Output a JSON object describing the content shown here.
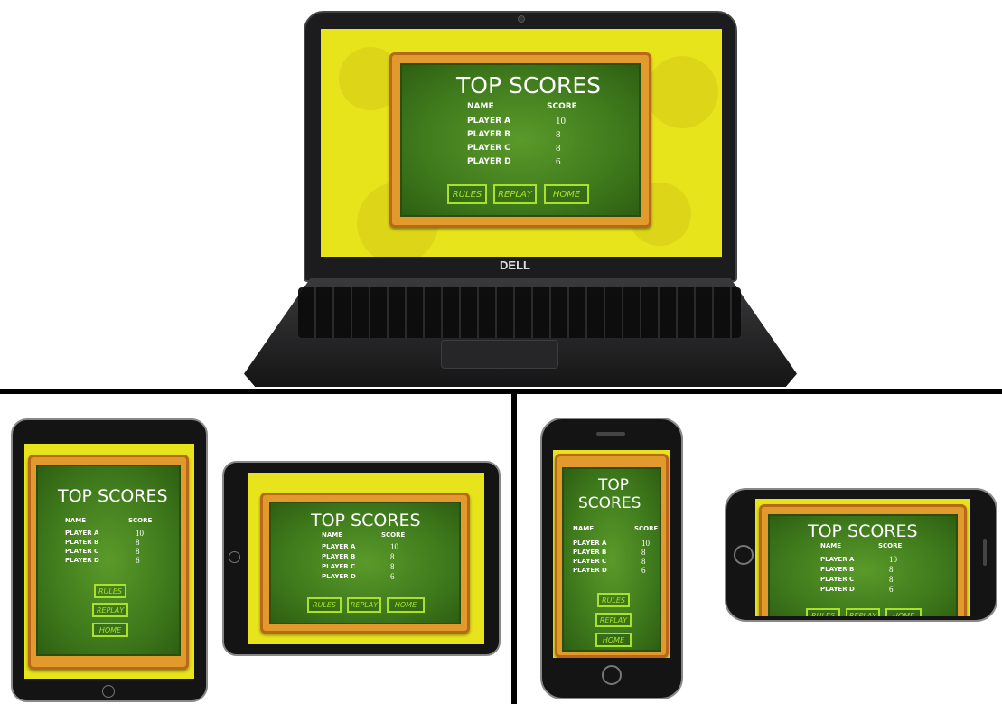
{
  "laptop_brand": "DELL",
  "game": {
    "title": "TOP SCORES",
    "title_line1": "TOP",
    "title_line2": "SCORES",
    "col_name": "NAME",
    "col_score": "SCORE",
    "players": [
      {
        "name": "PLAYER A",
        "score": "10"
      },
      {
        "name": "PLAYER B",
        "score": "8"
      },
      {
        "name": "PLAYER C",
        "score": "8"
      },
      {
        "name": "PLAYER D",
        "score": "6"
      }
    ],
    "buttons": {
      "rules": "RULES",
      "replay": "REPLAY",
      "home": "HOME"
    }
  },
  "colors": {
    "background": "#e8e41b",
    "frame": "#e39a2c",
    "board": "#3f7a1c",
    "button_outline": "#a8e22a"
  }
}
